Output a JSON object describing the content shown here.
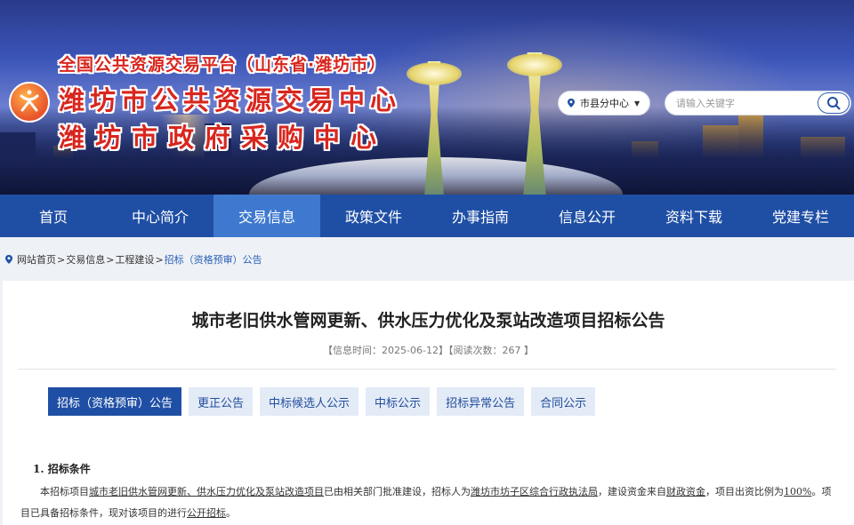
{
  "header": {
    "platform_title": "全国公共资源交易平台（山东省·潍坊市）",
    "title_line1": "潍坊市公共资源交易中心",
    "title_line2": "潍坊市政府采购中心",
    "city_select": "市县分中心",
    "search_placeholder": "请输入关键字"
  },
  "nav": {
    "items": [
      "首页",
      "中心简介",
      "交易信息",
      "政策文件",
      "办事指南",
      "信息公开",
      "资料下载",
      "党建专栏"
    ],
    "active": "交易信息"
  },
  "breadcrumb": {
    "home": "网站首页",
    "level2": "交易信息",
    "level3": "工程建设",
    "current": "招标（资格预审）公告",
    "separator": ">"
  },
  "article": {
    "title": "城市老旧供水管网更新、供水压力优化及泵站改造项目招标公告",
    "meta": "【信息时间：2025-06-12】【阅读次数：267 】",
    "tabs": [
      "招标（资格预审）公告",
      "更正公告",
      "中标候选人公示",
      "中标公示",
      "招标异常公告",
      "合同公示"
    ],
    "active_tab": "招标（资格预审）公告",
    "section1_heading": "1. 招标条件",
    "para": {
      "p1": "本招标项目",
      "project": "城市老旧供水管网更新、供水压力优化及泵站改造项目",
      "p2": "已由相关部门批准建设，招标人为",
      "tenderer": "潍坊市坊子区综合行政执法局",
      "p3": "，建设资金来自",
      "fund": "财政资金",
      "p4": "，项目出资比例为",
      "ratio": "100%",
      "p5": "。项目已具备招标条件，现对该项目的进行",
      "method": "公开招标",
      "p6": "。"
    }
  }
}
